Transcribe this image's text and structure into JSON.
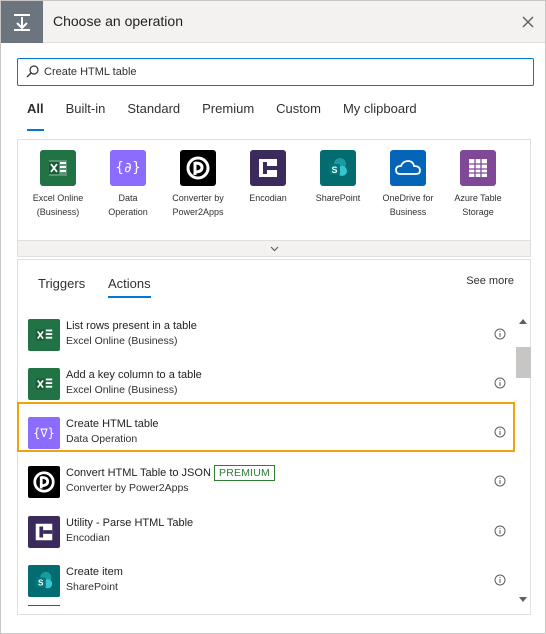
{
  "header": {
    "title": "Choose an operation"
  },
  "search": {
    "value": "Create HTML table",
    "placeholder": ""
  },
  "tabs": [
    {
      "label": "All"
    },
    {
      "label": "Built-in"
    },
    {
      "label": "Standard"
    },
    {
      "label": "Premium"
    },
    {
      "label": "Custom"
    },
    {
      "label": "My clipboard"
    }
  ],
  "connectors": [
    {
      "label1": "Excel Online",
      "label2": "(Business)",
      "color": "#217346",
      "icon": "excel-icon"
    },
    {
      "label1": "Data",
      "label2": "Operation",
      "color": "#8c6cff",
      "icon": "data-operation-icon"
    },
    {
      "label1": "Converter by",
      "label2": "Power2Apps",
      "color": "#000000",
      "icon": "power2apps-icon"
    },
    {
      "label1": "Encodian",
      "label2": "",
      "color": "#3b2b5c",
      "icon": "encodian-icon"
    },
    {
      "label1": "SharePoint",
      "label2": "",
      "color": "#036c70",
      "icon": "sharepoint-icon"
    },
    {
      "label1": "OneDrive for",
      "label2": "Business",
      "color": "#0364b8",
      "icon": "onedrive-icon"
    },
    {
      "label1": "Azure Table",
      "label2": "Storage",
      "color": "#804998",
      "icon": "azure-table-icon"
    }
  ],
  "subtabs": {
    "triggers": "Triggers",
    "actions": "Actions",
    "see_more": "See more"
  },
  "actions": [
    {
      "title": "List rows present in a table",
      "sub": "Excel Online (Business)",
      "color": "#217346",
      "icon": "excel-icon"
    },
    {
      "title": "Add a key column to a table",
      "sub": "Excel Online (Business)",
      "color": "#217346",
      "icon": "excel-icon"
    },
    {
      "title": "Create HTML table",
      "sub": "Data Operation",
      "color": "#8c6cff",
      "icon": "data-operation-icon"
    },
    {
      "title": "Convert HTML Table to JSON",
      "sub": "Converter by Power2Apps",
      "color": "#000000",
      "icon": "power2apps-icon",
      "badge": "PREMIUM"
    },
    {
      "title": "Utility - Parse HTML Table",
      "sub": "Encodian",
      "color": "#3b2b5c",
      "icon": "encodian-icon"
    },
    {
      "title": "Create item",
      "sub": "SharePoint",
      "color": "#036c70",
      "icon": "sharepoint-icon"
    }
  ],
  "colors": {
    "accent": "#0078d4",
    "selected_border": "#f0a30a",
    "premium": "#2e7d32"
  }
}
